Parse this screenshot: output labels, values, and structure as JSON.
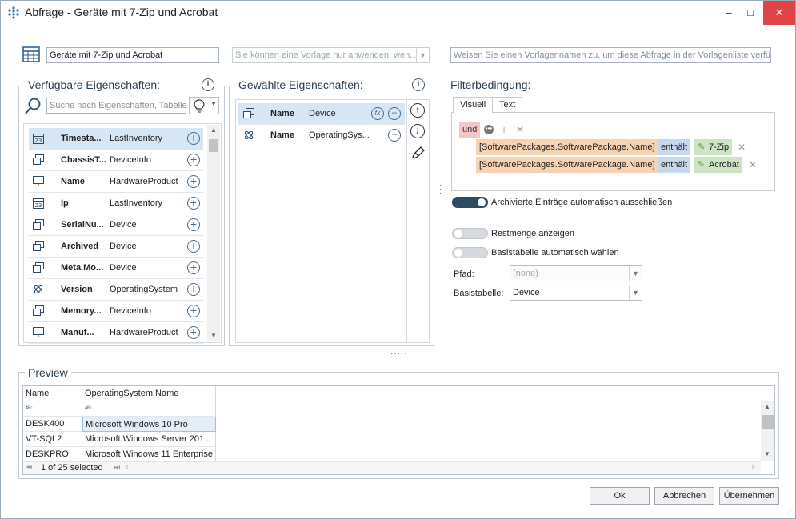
{
  "window": {
    "title": "Abfrage - Geräte mit 7-Zip und Acrobat",
    "minimize": "–",
    "maximize": "□",
    "close": "✕"
  },
  "header": {
    "query_name": "Geräte mit 7-Zip und Acrobat",
    "template_select": "Sie können eine Vorlage nur anwenden, wen...",
    "template_name_placeholder": "Weisen Sie einen Vorlagennamen zu, um diese Abfrage in der Vorlagenliste verfügb"
  },
  "available": {
    "title": "Verfügbare Eigenschaften:",
    "search_placeholder": "Suche nach Eigenschaften, Tabellen",
    "items": [
      {
        "name": "Timesta...",
        "table": "LastInventory",
        "icon": "calendar-icon",
        "selected": true
      },
      {
        "name": "ChassisT...",
        "table": "DeviceInfo",
        "icon": "device-icon",
        "selected": false
      },
      {
        "name": "Name",
        "table": "HardwareProduct",
        "icon": "computer-icon",
        "selected": false
      },
      {
        "name": "Ip",
        "table": "LastInventory",
        "icon": "calendar-icon",
        "selected": false
      },
      {
        "name": "SerialNu...",
        "table": "Device",
        "icon": "device-icon",
        "selected": false
      },
      {
        "name": "Archived",
        "table": "Device",
        "icon": "device-icon",
        "selected": false
      },
      {
        "name": "Meta.Mo...",
        "table": "Device",
        "icon": "device-icon",
        "selected": false
      },
      {
        "name": "Version",
        "table": "OperatingSystem",
        "icon": "os-icon",
        "selected": false
      },
      {
        "name": "Memory...",
        "table": "DeviceInfo",
        "icon": "device-icon",
        "selected": false
      },
      {
        "name": "Manuf...",
        "table": "HardwareProduct",
        "icon": "computer-icon",
        "selected": false
      }
    ]
  },
  "selected": {
    "title": "Gewählte Eigenschaften:",
    "items": [
      {
        "name": "Name",
        "table": "Device",
        "icon": "device-icon",
        "selected": true
      },
      {
        "name": "Name",
        "table": "OperatingSys...",
        "icon": "os-icon",
        "selected": false
      }
    ]
  },
  "filter": {
    "title": "Filterbedingung:",
    "tabs": [
      "Visuell",
      "Text"
    ],
    "operator": "und",
    "conditions": [
      {
        "field": "[SoftwarePackages.SoftwarePackage.Name]",
        "op": "enthält",
        "value": "7-Zip"
      },
      {
        "field": "[SoftwarePackages.SoftwarePackage.Name]",
        "op": "enthält",
        "value": "Acrobat"
      }
    ],
    "archived_label": "Archivierte Einträge automatisch ausschließen",
    "rest_label": "Restmenge anzeigen",
    "basetable_auto_label": "Basistabelle automatisch wählen",
    "path_label": "Pfad:",
    "path_value": "(none)",
    "basetable_label": "Basistabelle:",
    "basetable_value": "Device"
  },
  "preview": {
    "title": "Preview",
    "columns": [
      "Name",
      "OperatingSystem.Name"
    ],
    "rows": [
      [
        "DESK400",
        "Microsoft Windows 10 Pro"
      ],
      [
        "VT-SQL2",
        "Microsoft Windows Server 201..."
      ],
      [
        "DESKPRO",
        "Microsoft Windows 11 Enterprise"
      ]
    ],
    "status": "1 of 25 selected"
  },
  "buttons": {
    "ok": "Ok",
    "cancel": "Abbrechen",
    "apply": "Übernehmen"
  }
}
